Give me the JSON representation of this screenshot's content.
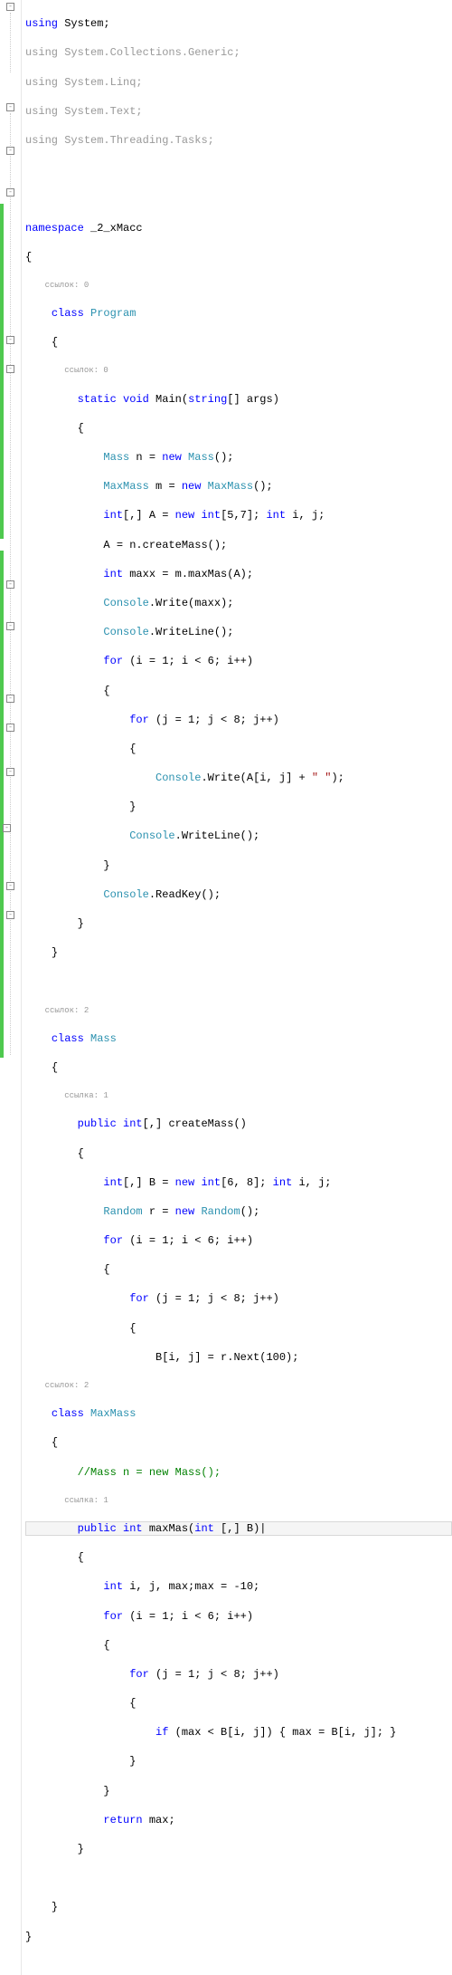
{
  "usings": {
    "u0": "using",
    "u0t": " System;",
    "u1": "using",
    "u1t": " System.Collections.Generic;",
    "u2": "using",
    "u2t": " System.Linq;",
    "u3": "using",
    "u3t": " System.Text;",
    "u4": "using",
    "u4t": " System.Threading.Tasks;"
  },
  "ns": {
    "kw": "namespace",
    "name": " _2_xMacc",
    "open": "{",
    "close": "}"
  },
  "lens": {
    "r0": "ссылок: 0",
    "r1": "ссылок: 0",
    "r2": "ссылок: 2",
    "r3": "ссылка: 1",
    "r4": "ссылок: 2",
    "r5": "ссылка: 1"
  },
  "cls": {
    "kw": "class",
    "prog": " Program",
    "mass": " Mass",
    "maxmass": " MaxMass",
    "open": "{",
    "close": "}"
  },
  "main": {
    "sig_a": "static",
    "sig_b": " void",
    "sig_c": " Main(",
    "sig_d": "string",
    "sig_e": "[] args)",
    "open": "{",
    "l1a": "Mass",
    "l1b": " n = ",
    "l1c": "new",
    "l1d": " Mass",
    "l1e": "();",
    "l2a": "MaxMass",
    "l2b": " m = ",
    "l2c": "new",
    "l2d": " MaxMass",
    "l2e": "();",
    "l3a": "int",
    "l3b": "[,] A = ",
    "l3c": "new",
    "l3d": " int",
    "l3e": "[5,7]; ",
    "l3f": "int",
    "l3g": " i, j;",
    "l4": "A = n.createMass();",
    "l5a": "int",
    "l5b": " maxx = m.maxMas(A);",
    "l6a": "Console",
    "l6b": ".Write(maxx);",
    "l7a": "Console",
    "l7b": ".WriteLine();",
    "l8a": "for",
    "l8b": " (i = 1; i < 6; i++)",
    "l8o": "{",
    "l9a": "for",
    "l9b": " (j = 1; j < 8; j++)",
    "l9o": "{",
    "l10a": "Console",
    "l10b": ".Write(A[i, j] + ",
    "l10c": "\" \"",
    "l10d": ");",
    "l9c": "}",
    "l11a": "Console",
    "l11b": ".WriteLine();",
    "l8c": "}",
    "l12a": "Console",
    "l12b": ".ReadKey();",
    "close": "}"
  },
  "create": {
    "sig_a": "public",
    "sig_b": " int",
    "sig_c": "[,] createMass()",
    "open": "{",
    "l1a": "int",
    "l1b": "[,] B = ",
    "l1c": "new",
    "l1d": " int",
    "l1e": "[6, 8]; ",
    "l1f": "int",
    "l1g": " i, j;",
    "l2a": "Random",
    "l2b": " r = ",
    "l2c": "new",
    "l2d": " Random",
    "l2e": "();",
    "l3a": "for",
    "l3b": " (i = 1; i < 6; i++)",
    "l3o": "{",
    "l4a": "for",
    "l4b": " (j = 1; j < 8; j++)",
    "l4o": "{",
    "l5": "B[i, j] = r.Next(100);"
  },
  "max": {
    "comment": "//Mass n = new Mass();",
    "sig_a": "public",
    "sig_b": " int",
    "sig_c": " maxMas(",
    "sig_d": "int",
    "sig_e": " [,] B)",
    "cursor": "|",
    "open": "{",
    "l1a": "int",
    "l1b": " i, j, max;max = -10;",
    "l2a": "for",
    "l2b": " (i = 1; i < 6; i++)",
    "l2o": "{",
    "l3a": "for",
    "l3b": " (j = 1; j < 8; j++)",
    "l3o": "{",
    "l4a": "if",
    "l4b": " (max < B[i, j]) { max = B[i, j]; }",
    "l3c": "}",
    "l2c": "}",
    "l5a": "return",
    "l5b": " max;",
    "close": "}"
  },
  "indent": {
    "i1": "    ",
    "i2": "        ",
    "i3": "            ",
    "i4": "                ",
    "i5": "                    ",
    "i6": "                        "
  }
}
